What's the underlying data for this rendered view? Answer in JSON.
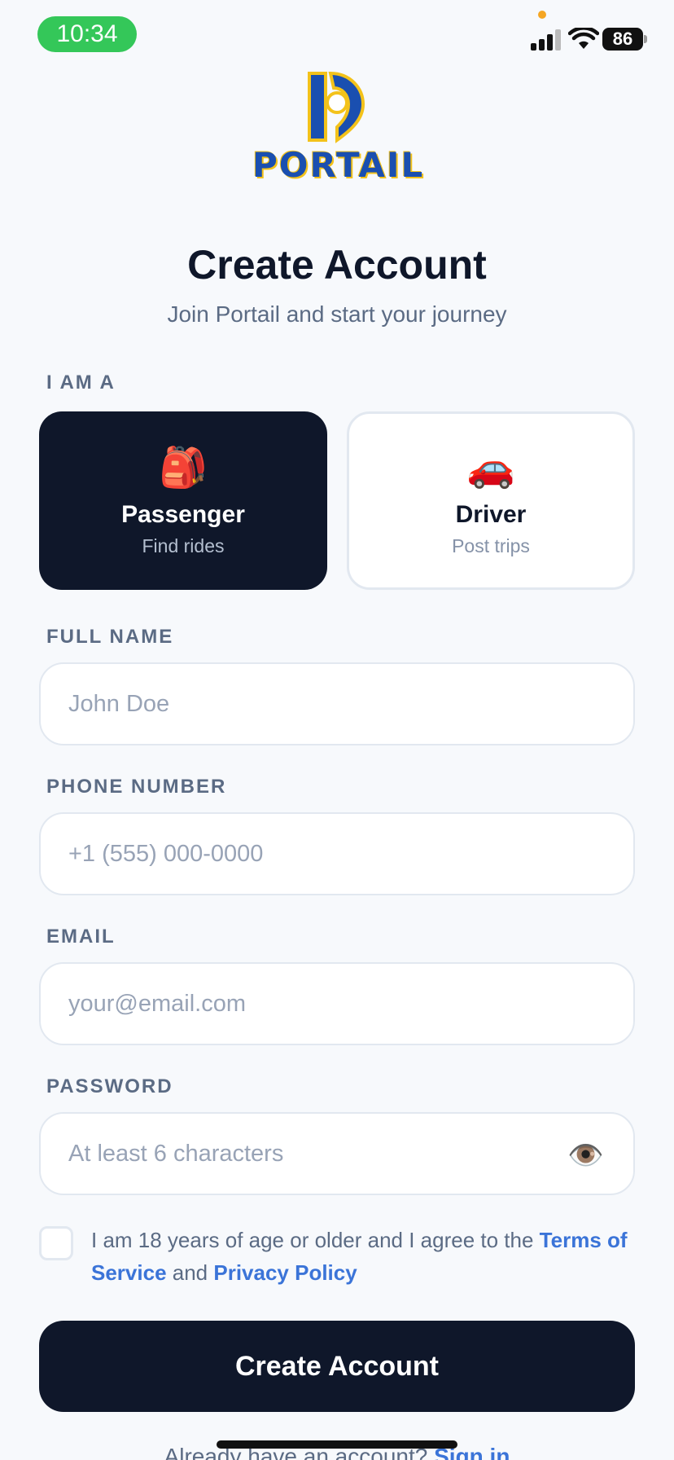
{
  "status": {
    "time": "10:34",
    "battery": "86"
  },
  "logo": {
    "text": "PORTAIL"
  },
  "header": {
    "title": "Create Account",
    "subtitle": "Join Portail and start your journey"
  },
  "role": {
    "label": "I AM A",
    "options": [
      {
        "title": "Passenger",
        "subtitle": "Find rides",
        "icon": "backpack-icon",
        "selected": true
      },
      {
        "title": "Driver",
        "subtitle": "Post trips",
        "icon": "car-icon",
        "selected": false
      }
    ]
  },
  "form": {
    "full_name": {
      "label": "FULL NAME",
      "placeholder": "John Doe",
      "value": ""
    },
    "phone": {
      "label": "PHONE NUMBER",
      "placeholder": "+1 (555) 000-0000",
      "value": ""
    },
    "email": {
      "label": "EMAIL",
      "placeholder": "your@email.com",
      "value": ""
    },
    "password": {
      "label": "PASSWORD",
      "placeholder": "At least 6 characters",
      "value": ""
    }
  },
  "terms": {
    "text_before": "I am 18 years of age or older and I agree to the ",
    "terms_link": "Terms of Service",
    "text_and": " and ",
    "privacy_link": "Privacy Policy",
    "checked": false
  },
  "submit": {
    "label": "Create Account"
  },
  "signin": {
    "prompt": "Already have an account? ",
    "link": "Sign in"
  },
  "colors": {
    "primary": "#0f172a",
    "accent": "#3b74d8",
    "status_green": "#34c759"
  }
}
